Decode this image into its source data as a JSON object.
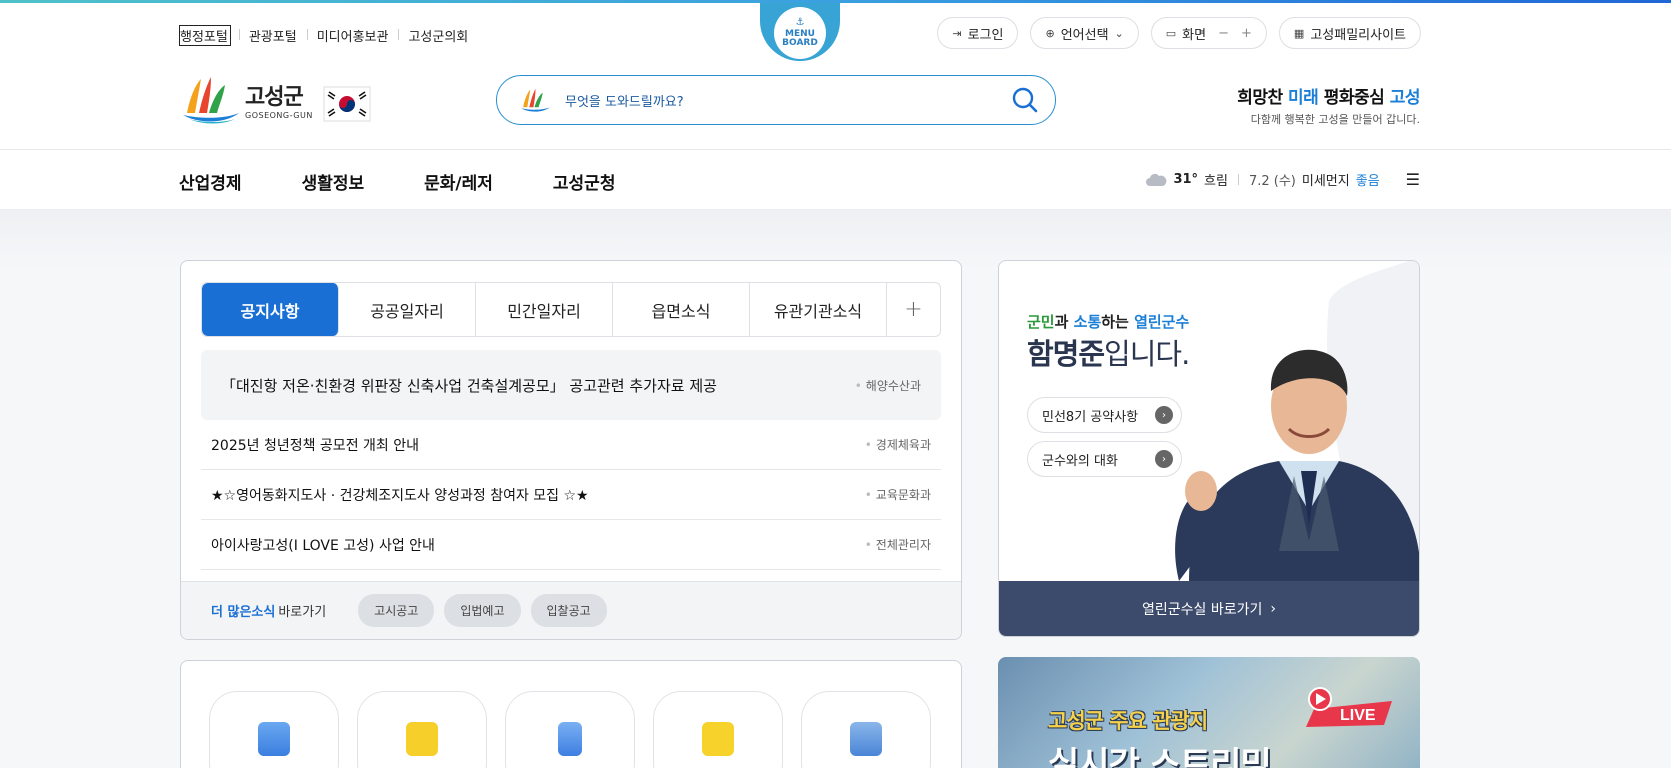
{
  "util_left": [
    "행정포털",
    "관광포털",
    "미디어홍보관",
    "고성군의회"
  ],
  "menuboard": {
    "line1": "MENU",
    "line2": "BOARD"
  },
  "util_right": {
    "login": "로그인",
    "language": "언어선택",
    "screen": "화면",
    "zoom_out": "−",
    "zoom_in": "+",
    "family": "고성패밀리사이트"
  },
  "logo": {
    "kr": "고성군",
    "en": "GOSEONG-GUN"
  },
  "search": {
    "placeholder": "무엇을 도와드릴까요?"
  },
  "slogan": {
    "part1": "희망찬 ",
    "part2": "미래",
    "part3": " 평화중심 ",
    "part4": "고성",
    "sub": "다함께 행복한 고성을 만들어 갑니다."
  },
  "gnb": [
    "산업경제",
    "생활정보",
    "문화/레저",
    "고성군청"
  ],
  "weather": {
    "temp": "31°",
    "condition": "흐림",
    "date": "7.2 (수)",
    "dust_label": "미세먼지",
    "dust_value": "좋음"
  },
  "notice": {
    "tabs": [
      "공지사항",
      "공공일자리",
      "민간일자리",
      "읍면소식",
      "유관기관소식"
    ],
    "items": [
      {
        "title": "「대진항 저온·친환경 위판장 신축사업 건축설계공모」 공고관련 추가자료 제공",
        "dept": "해양수산과"
      },
      {
        "title": "2025년 청년정책 공모전 개최 안내",
        "dept": "경제체육과"
      },
      {
        "title": "★☆영어동화지도사 · 건강체조지도사 양성과정 참여자 모집 ☆★",
        "dept": "교육문화과"
      },
      {
        "title": "아이사랑고성(I LOVE 고성) 사업 안내",
        "dept": "전체관리자"
      }
    ],
    "more_bold": "더 많은소식",
    "more": "바로가기",
    "chips": [
      "고시공고",
      "입법예고",
      "입찰공고"
    ]
  },
  "mayor": {
    "l1a": "군민",
    "l1b": "과 ",
    "l1c": "소통",
    "l1d": "하는 ",
    "l1e": "열린군수",
    "l2a": "함명준",
    "l2b": "입니다.",
    "btn1": "민선8기 공약사항",
    "btn2": "군수와의 대화",
    "bar": "열린군수실 바로가기"
  },
  "live": {
    "title": "고성군 주요 관광지",
    "title2": "실시간 스트리밍",
    "badge": "LIVE"
  },
  "colors": {
    "primary": "#1a6fd4",
    "accent": "#1a7fd6",
    "navy": "#3c4a6b"
  }
}
